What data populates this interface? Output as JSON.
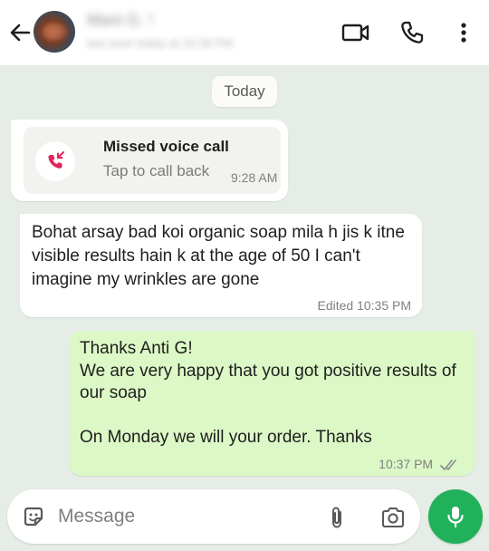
{
  "header": {
    "contact_name": "Mani G. !",
    "contact_status": "last seen today at 10:38 PM",
    "icons": {
      "back": "arrow-left-icon",
      "video": "video-call-icon",
      "call": "phone-icon",
      "menu": "more-vertical-icon"
    }
  },
  "chat": {
    "date_label": "Today",
    "missed_call": {
      "title": "Missed voice call",
      "subtitle": "Tap to call back",
      "time": "9:28 AM",
      "icon": "missed-call-icon",
      "icon_color": "#e0245e"
    },
    "incoming_message": {
      "text": "Bohat arsay bad koi organic soap mila h jis k itne visible results hain k at the age of 50 I can't imagine my wrinkles are gone",
      "meta": "Edited 10:35 PM"
    },
    "outgoing_message": {
      "line1": "Thanks Anti G!",
      "line2": "We are very happy that you got positive results of our soap",
      "line3": "On Monday we will your order. Thanks",
      "time": "10:37 PM",
      "status_icon": "double-check-icon"
    }
  },
  "composer": {
    "placeholder": "Message",
    "icons": {
      "sticker": "sticker-icon",
      "attach": "paperclip-icon",
      "camera": "camera-icon",
      "mic": "microphone-icon"
    },
    "mic_color": "#21b15a"
  },
  "colors": {
    "background": "#e5ede6",
    "outgoing_bubble": "#dcf8c6",
    "incoming_bubble": "#ffffff"
  }
}
